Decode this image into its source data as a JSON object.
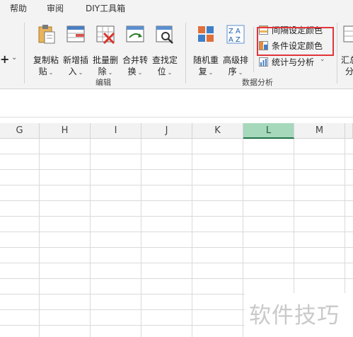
{
  "tabs": [
    "帮助",
    "审阅",
    "DIY工具箱"
  ],
  "ribbon": {
    "partial_left_icon": "+",
    "partial_left_chev": "⌄",
    "edit_group": {
      "label": "编辑",
      "buttons": [
        {
          "line1": "复制粘",
          "line2": "贴",
          "icon": "paste-icon"
        },
        {
          "line1": "新增插",
          "line2": "入",
          "icon": "insert-icon"
        },
        {
          "line1": "批量删",
          "line2": "除",
          "icon": "delete-icon"
        },
        {
          "line1": "合并转",
          "line2": "换",
          "icon": "merge-icon"
        },
        {
          "line1": "查找定",
          "line2": "位",
          "icon": "find-icon"
        }
      ]
    },
    "analysis_group": {
      "label": "数据分析",
      "buttons": [
        {
          "line1": "随机重",
          "line2": "复",
          "icon": "random-icon"
        },
        {
          "line1": "高级排",
          "line2": "序",
          "icon": "sort-icon"
        }
      ],
      "small_items": [
        {
          "label": "间隔设定颜色",
          "icon": "interval-color-icon",
          "highlighted": true
        },
        {
          "label": "条件设定颜色",
          "icon": "condition-color-icon",
          "highlighted": false
        },
        {
          "label": "统计与分析",
          "icon": "stats-icon",
          "highlighted": false,
          "has_dropdown": true
        }
      ]
    },
    "partial_right": {
      "line1": "汇总",
      "line2": "分"
    }
  },
  "columns": [
    "G",
    "H",
    "I",
    "J",
    "K",
    "L",
    "M"
  ],
  "selected_column": "L",
  "colors": {
    "ribbon_bg": "#f3f3f3",
    "selected_header": "#a6d8bc",
    "highlight_border": "#e0353b"
  },
  "watermark": "软件技巧"
}
